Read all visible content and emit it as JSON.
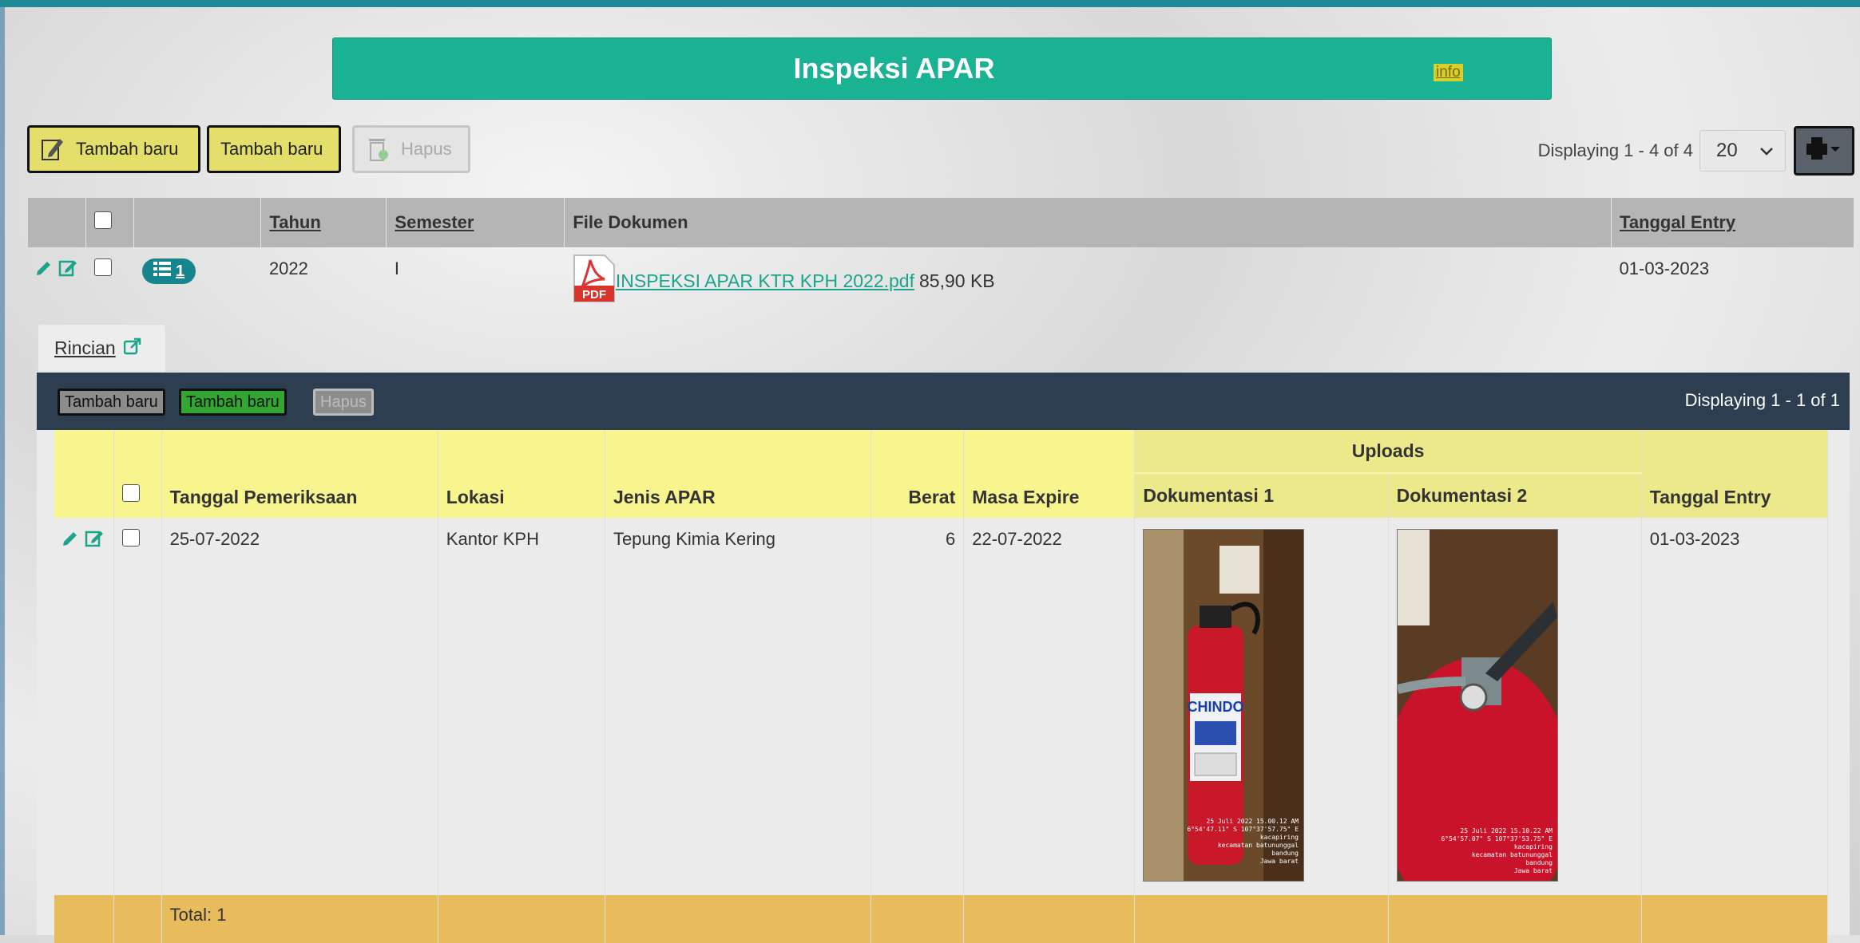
{
  "header": {
    "title": "Inspeksi APAR",
    "info_label": "info"
  },
  "toolbar": {
    "add_label_1": "Tambah baru",
    "add_label_2": "Tambah baru",
    "delete_label": "Hapus",
    "displaying": "Displaying 1 - 4 of 4",
    "page_size": "20"
  },
  "main_table": {
    "columns": {
      "tahun": "Tahun",
      "semester": "Semester",
      "file": "File Dokumen",
      "tanggal_entry": "Tanggal Entry"
    },
    "row": {
      "badge": "1",
      "tahun": "2022",
      "semester": "I",
      "file_name": "INSPEKSI APAR KTR KPH 2022.pdf",
      "file_size": "85,90 KB",
      "tanggal_entry": "01-03-2023"
    }
  },
  "detail_tab": {
    "label": "Rincian"
  },
  "detail": {
    "add_label_1": "Tambah baru",
    "add_label_2": "Tambah baru",
    "delete_label": "Hapus",
    "displaying": "Displaying 1 - 1 of 1",
    "columns": {
      "uploads": "Uploads",
      "tanggal_pemeriksaan": "Tanggal Pemeriksaan",
      "lokasi": "Lokasi",
      "jenis": "Jenis APAR",
      "berat": "Berat",
      "masa_expire": "Masa Expire",
      "dok1": "Dokumentasi 1",
      "dok2": "Dokumentasi 2",
      "tanggal_entry": "Tanggal Entry"
    },
    "row": {
      "tanggal_pemeriksaan": "25-07-2022",
      "lokasi": "Kantor KPH",
      "jenis": "Tepung Kimia Kering",
      "berat": "6",
      "masa_expire": "22-07-2022",
      "tanggal_entry": "01-03-2023"
    },
    "photo1_stamp": [
      "25 Juli 2022  15.00.12 AM",
      "6°54'47.11\" S 107°37'57.75\" E",
      "kacapiring",
      "kecamatan batununggal",
      "bandung",
      "Jawa barat"
    ],
    "photo2_stamp": [
      "25 Juli 2022  15.10.22 AM",
      "6°54'57.07\" S 107°37'53.75\" E",
      "kacapiring",
      "kecamatan batununggal",
      "bandung",
      "Jawa barat"
    ],
    "extinguisher_brand": "CHINDO",
    "total": "Total: 1"
  },
  "colors": {
    "accent": "#19b394",
    "dark": "#2c3e50",
    "button_yellow": "#e3df6a",
    "header_yellow": "#f8f58f",
    "total_orange": "#e8bb5d"
  }
}
